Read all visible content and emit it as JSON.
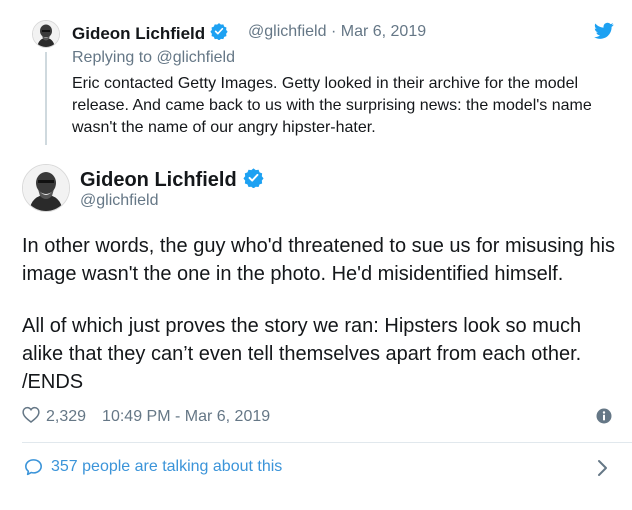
{
  "parent_tweet": {
    "author_name": "Gideon Lichfield",
    "handle": "@glichfield",
    "separator": "·",
    "date": "Mar 6, 2019",
    "reply_prefix": "Replying to",
    "reply_handle": "@glichfield",
    "text": "Eric contacted Getty Images. Getty looked in their archive for the model release. And came back to us with the surprising news: the model's name wasn't the name of our angry hipster-hater."
  },
  "main_tweet": {
    "author_name": "Gideon Lichfield",
    "handle": "@glichfield",
    "paragraph_1": "In other words, the guy who'd threatened to sue us for misusing his image wasn't the one in the photo. He'd misidentified himself.",
    "paragraph_2": "All of which just proves the story we ran: Hipsters look so much alike that they can’t even tell themselves apart from each other. /ENDS",
    "likes": "2,329",
    "timestamp": "10:49 PM - Mar 6, 2019"
  },
  "conversation": {
    "label": "357 people are talking about this"
  },
  "icons": {
    "brand": "twitter-bird-icon",
    "verified": "verified-badge-icon",
    "like": "heart-icon",
    "info": "info-icon",
    "conversation": "speech-bubble-icon",
    "chevron": "chevron-right-icon"
  },
  "colors": {
    "twitter_blue": "#1da1f2",
    "link_blue": "#3b94d9",
    "meta_gray": "#657786",
    "text": "#14171a"
  }
}
